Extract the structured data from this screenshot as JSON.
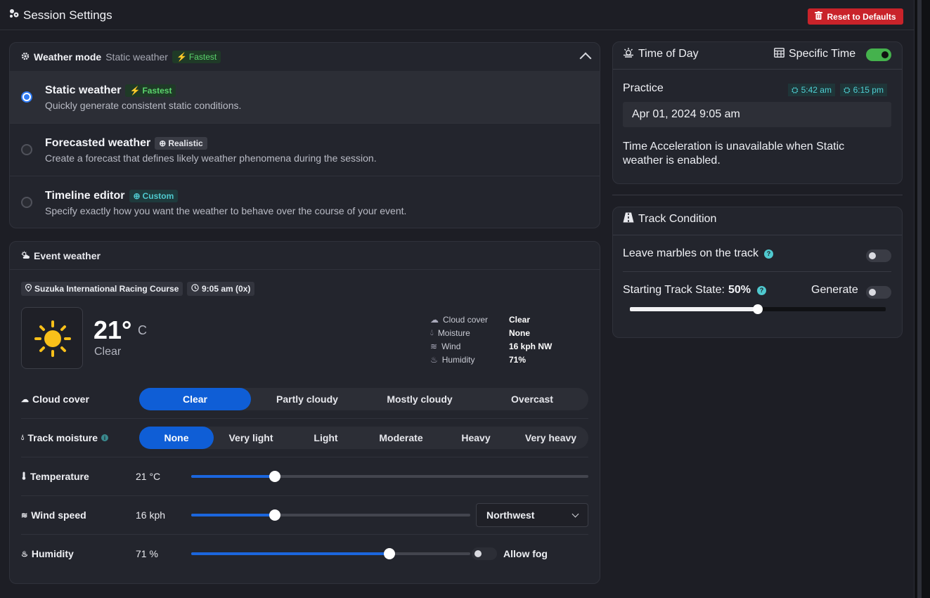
{
  "app": {
    "title": "Session Settings",
    "reset_label": "Reset to Defaults"
  },
  "weather_mode": {
    "label": "Weather mode",
    "current": "Static weather",
    "current_badge": "Fastest",
    "options": [
      {
        "title": "Static weather",
        "badge": "Fastest",
        "badge_style": "green",
        "desc": "Quickly generate consistent static conditions.",
        "selected": true
      },
      {
        "title": "Forecasted weather",
        "badge": "Realistic",
        "badge_style": "grey",
        "desc": "Create a forecast that defines likely weather phenomena during the session.",
        "selected": false
      },
      {
        "title": "Timeline editor",
        "badge": "Custom",
        "badge_style": "teal",
        "desc": "Specify exactly how you want the weather to behave over the course of your event.",
        "selected": false
      }
    ]
  },
  "event_weather": {
    "title": "Event weather",
    "track": "Suzuka International Racing Course",
    "time": "9:05 am (0x)",
    "temperature": "21°",
    "temp_unit": "C",
    "condition": "Clear",
    "stats": [
      {
        "label": "Cloud cover",
        "value": "Clear",
        "icon": "cloud-icon"
      },
      {
        "label": "Moisture",
        "value": "None",
        "icon": "droplets-icon"
      },
      {
        "label": "Wind",
        "value": "16 kph NW",
        "icon": "wind-icon"
      },
      {
        "label": "Humidity",
        "value": "71%",
        "icon": "humidity-icon"
      }
    ],
    "cloud_cover": {
      "label": "Cloud cover",
      "options": [
        "Clear",
        "Partly cloudy",
        "Mostly cloudy",
        "Overcast"
      ],
      "selected": "Clear"
    },
    "track_moisture": {
      "label": "Track moisture",
      "options": [
        "None",
        "Very light",
        "Light",
        "Moderate",
        "Heavy",
        "Very heavy"
      ],
      "selected": "None"
    },
    "temperature_row": {
      "label": "Temperature",
      "value": "21 °C",
      "fraction": 0.21
    },
    "wind_row": {
      "label": "Wind speed",
      "value": "16 kph",
      "fraction": 0.3,
      "direction": "Northwest"
    },
    "humidity_row": {
      "label": "Humidity",
      "value": "71 %",
      "fraction": 0.71,
      "fog_label": "Allow fog",
      "fog_enabled": false
    }
  },
  "time_of_day": {
    "title": "Time of Day",
    "specific_label": "Specific Time",
    "specific_enabled": true,
    "session": "Practice",
    "sunrise": "5:42 am",
    "sunset": "6:15 pm",
    "datetime": "Apr 01, 2024 9:05 am",
    "note": "Time Acceleration is unavailable when Static weather is enabled."
  },
  "track_condition": {
    "title": "Track Condition",
    "marbles_label": "Leave marbles on the track",
    "marbles_enabled": false,
    "state_label": "Starting Track State:",
    "state_value": "50%",
    "state_fraction": 0.5,
    "generate_label": "Generate",
    "generate_enabled": false
  },
  "colors": {
    "accent": "#0f5ed6",
    "danger": "#c9232a",
    "toggle_on": "#45b24d",
    "teal": "#4fc9cf"
  }
}
